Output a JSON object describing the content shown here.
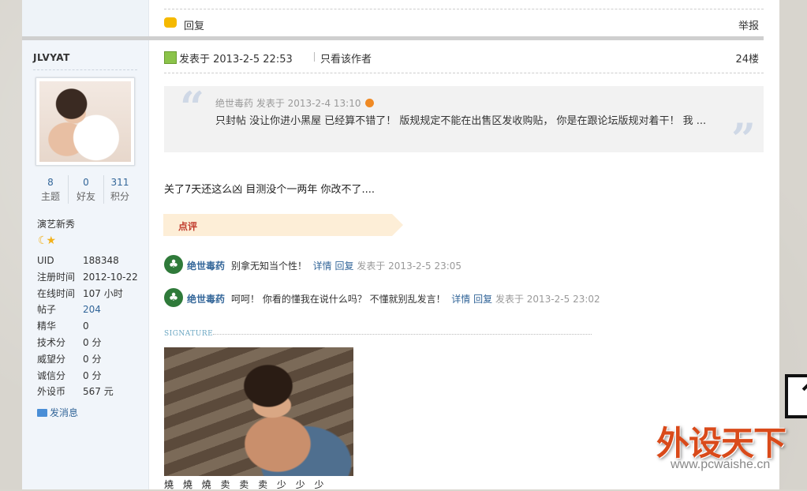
{
  "post": {
    "reply_label": "回复",
    "report_label": "举报",
    "posted_at": "发表于 2013-2-5 22:53",
    "only_author": "只看该作者",
    "floor": "24楼",
    "content": "关了7天还这么凶 目测没个一两年 你改不了...."
  },
  "quote": {
    "header": "绝世毒药 发表于 2013-2-4 13:10",
    "body": "只封帖  没让你进小黑屋 已经算不错了！   版规规定不能在出售区发收购贴， 你是在跟论坛版规对着干！   我 ..."
  },
  "comments_section": {
    "label": "点评",
    "items": [
      {
        "user": "绝世毒药",
        "text": "别拿无知当个性！",
        "detail": "详情",
        "reply": "回复",
        "time": "发表于 2013-2-5 23:05"
      },
      {
        "user": "绝世毒药",
        "text": "呵呵！ 你看的懂我在说什么吗？ 不懂就别乱发言！",
        "detail": "详情",
        "reply": "回复",
        "time": "发表于 2013-2-5 23:02"
      }
    ]
  },
  "signature": {
    "label": "SIGNATURE",
    "text": "燒 燒 燒 卖 卖 卖 少 少 少"
  },
  "user": {
    "name": "JLVYAT",
    "stats": [
      {
        "num": "8",
        "label": "主题"
      },
      {
        "num": "0",
        "label": "好友"
      },
      {
        "num": "311",
        "label": "积分"
      }
    ],
    "group": "演艺新秀",
    "info": [
      {
        "k": "UID",
        "v": "188348"
      },
      {
        "k": "注册时间",
        "v": "2012-10-22"
      },
      {
        "k": "在线时间",
        "v": "107 小时"
      },
      {
        "k": "帖子",
        "v": "204"
      },
      {
        "k": "精华",
        "v": "0"
      },
      {
        "k": "技术分",
        "v": "0 分"
      },
      {
        "k": "威望分",
        "v": "0 分"
      },
      {
        "k": "诚信分",
        "v": "0 分"
      },
      {
        "k": "外设币",
        "v": "567 元"
      }
    ],
    "send_message": "发消息"
  },
  "watermark": {
    "title": "外设天下",
    "url": "www.pcwaishe.cn"
  },
  "colors": {
    "link": "#336699",
    "comment_tab_bg": "#fdeed7",
    "comment_label": "#c0392b",
    "sidebar_bg": "#f1f5fa"
  }
}
